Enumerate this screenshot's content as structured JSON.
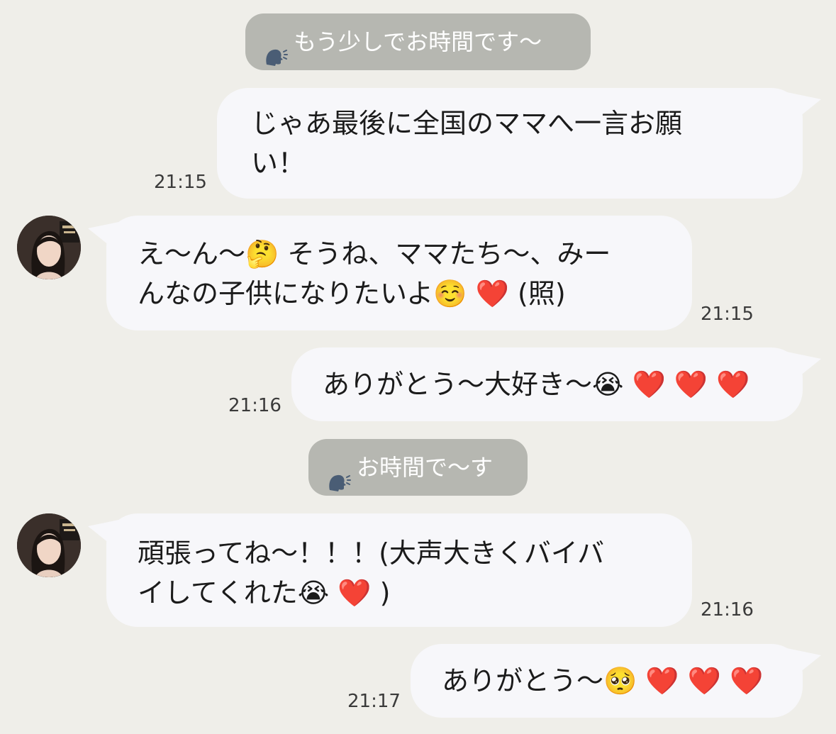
{
  "system": [
    {
      "text": "もう少しでお時間です〜",
      "icon": "speaking-head-icon"
    },
    {
      "text": "お時間で〜す",
      "icon": "speaking-head-icon"
    }
  ],
  "messages": [
    {
      "side": "right",
      "line1": "じゃあ最後に全国のママへ一言お願",
      "line2": "い！",
      "time": "21:15"
    },
    {
      "side": "left",
      "line1": "え〜ん〜🤔 そうね、ママたち〜、みー",
      "line2": "んなの子供になりたいよ☺️ ❤️ (照)",
      "time": "21:15"
    },
    {
      "side": "right",
      "line1": "ありがとう〜大好き〜😭 ❤️ ❤️ ❤️",
      "time": "21:16"
    },
    {
      "side": "left",
      "line1": "頑張ってね〜！！！(大声大きくバイバ",
      "line2": "イしてくれた😭 ❤️ )",
      "time": "21:16"
    },
    {
      "side": "right",
      "line1": "ありがとう〜🥺 ❤️ ❤️ ❤️",
      "time": "21:17"
    }
  ],
  "colors": {
    "background": "#efeee9",
    "bubble": "#f7f7fa",
    "system_pill": "#b6b7b1"
  }
}
